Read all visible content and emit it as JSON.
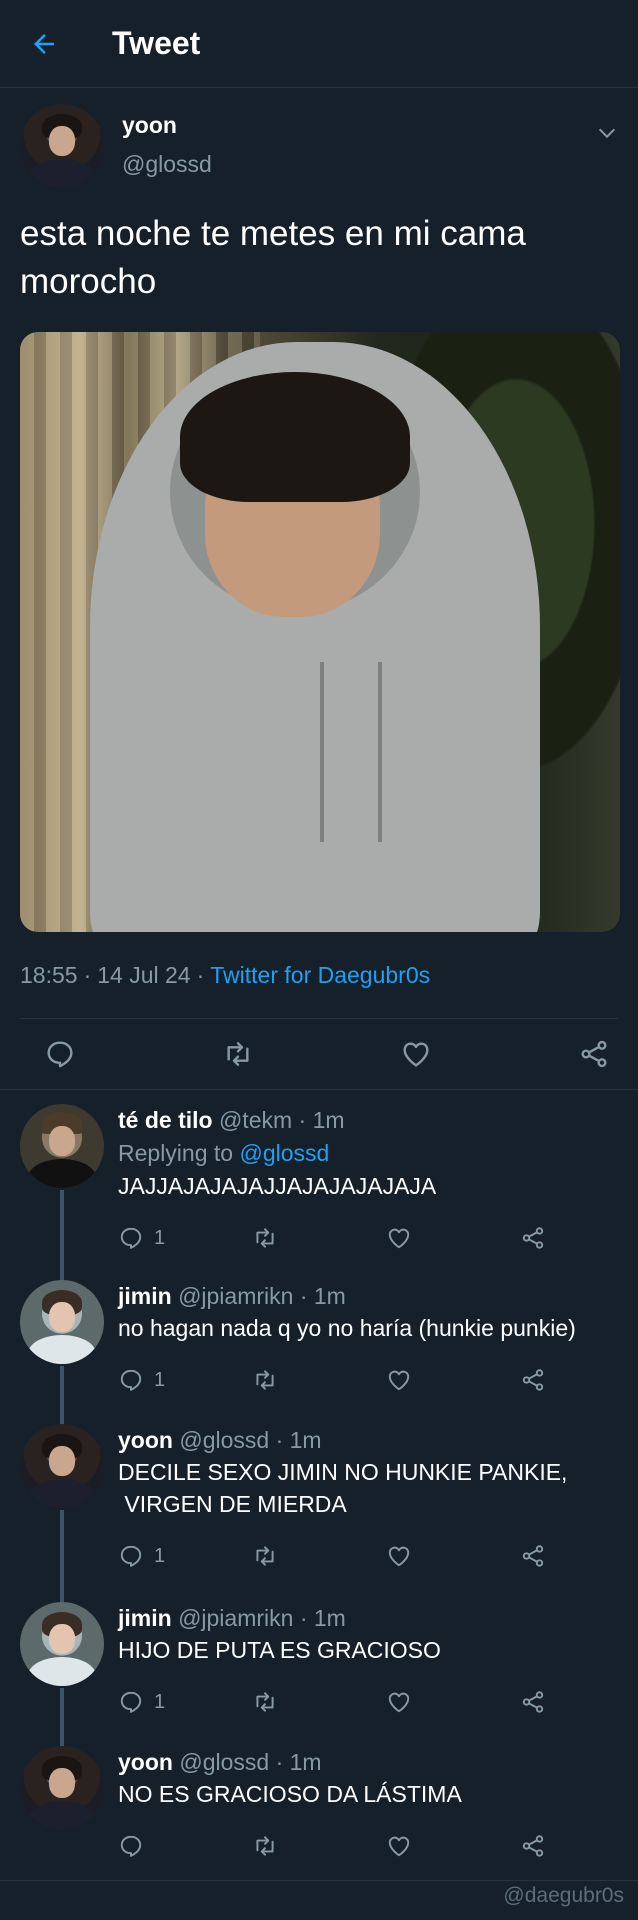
{
  "header": {
    "title": "Tweet",
    "back_icon": "arrow-left-icon",
    "accent": "#1da1f2"
  },
  "tweet": {
    "author_name": "yoon",
    "author_handle": "@glossd",
    "text_line1": "esta noche te metes en mi cama",
    "text_line2": "morocho",
    "time": "18:55",
    "date": "14 Jul 24",
    "source": "Twitter for Daegubr0s",
    "dot": "·"
  },
  "replies": [
    {
      "name": "té de tilo",
      "handle": "@tekm",
      "time": "1m",
      "replying_label": "Replying to",
      "replying_to": "@glossd",
      "body": "JAJJAJAJAJAJJAJAJAJAJAJA",
      "reply_count": "1"
    },
    {
      "name": "jimin",
      "handle": "@jpiamrikn",
      "time": "1m",
      "body": "no hagan nada q yo no haría (hunkie punkie)",
      "reply_count": "1"
    },
    {
      "name": "yoon",
      "handle": "@glossd",
      "time": "1m",
      "body_line1": "DECILE SEXO JIMIN NO HUNKIE PANKIE,",
      "body_line2": " VIRGEN DE MIERDA",
      "reply_count": "1"
    },
    {
      "name": "jimin",
      "handle": "@jpiamrikn",
      "time": "1m",
      "body": "HIJO DE PUTA ES GRACIOSO",
      "reply_count": "1"
    },
    {
      "name": "yoon",
      "handle": "@glossd",
      "time": "1m",
      "body": "NO ES GRACIOSO DA LÁSTIMA",
      "reply_count": ""
    }
  ],
  "watermark": "@daegubr0s",
  "colors": {
    "background": "#15202b",
    "secondary_text": "#8899a6",
    "link": "#1da1f2",
    "divider": "#253341"
  }
}
